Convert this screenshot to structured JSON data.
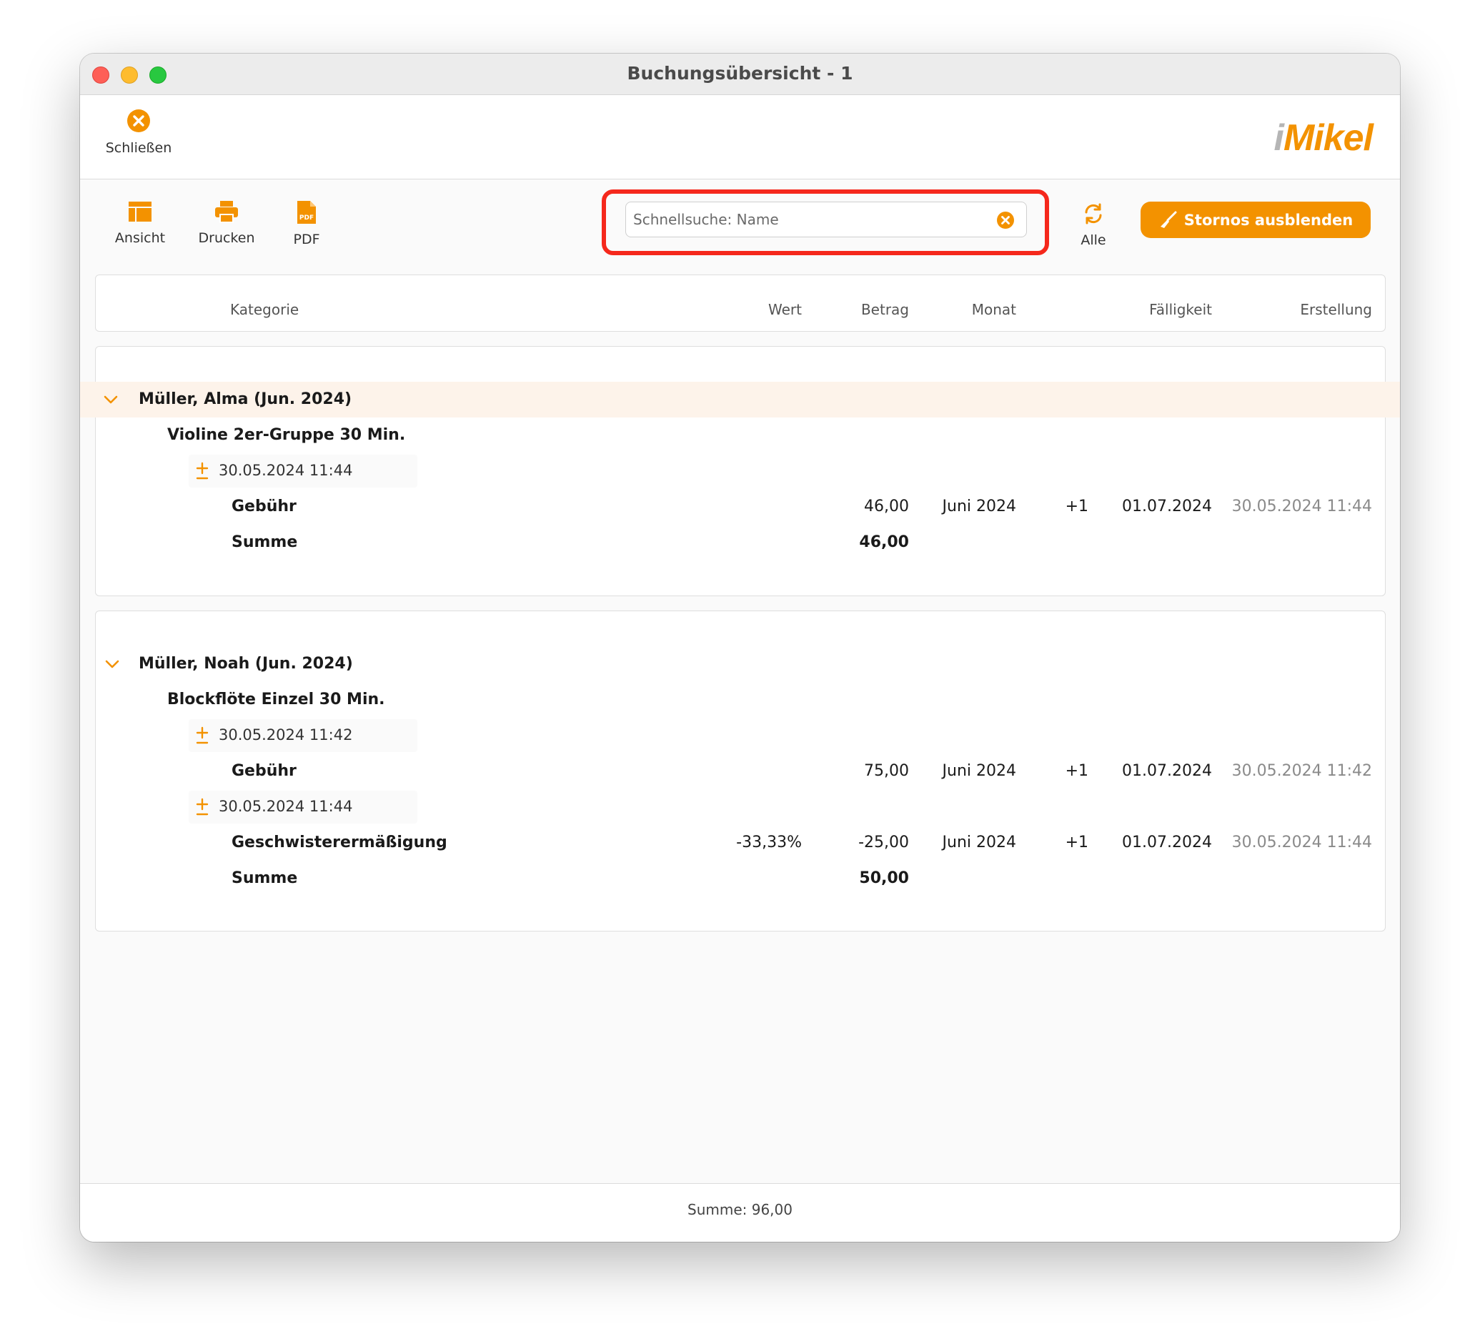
{
  "window": {
    "title": "Buchungsübersicht - 1"
  },
  "toolbar": {
    "close_label": "Schließen",
    "view_label": "Ansicht",
    "print_label": "Drucken",
    "pdf_label": "PDF",
    "logo_text_i": "i",
    "logo_text_rest": "Mikel"
  },
  "search": {
    "placeholder": "Schnellsuche: Name",
    "value": ""
  },
  "refresh_label": "Alle",
  "storno_button": "Stornos ausblenden",
  "columns": {
    "kategorie": "Kategorie",
    "wert": "Wert",
    "betrag": "Betrag",
    "monat": "Monat",
    "faelligkeit": "Fälligkeit",
    "erstellung": "Erstellung"
  },
  "groups": [
    {
      "name": "Müller, Alma (Jun. 2024)",
      "course": "Violine 2er-Gruppe 30 Min.",
      "entries": [
        {
          "timestamp": "30.05.2024 11:44",
          "category": "Gebühr",
          "wert": "",
          "betrag": "46,00",
          "monat": "Juni 2024",
          "offset": "+1",
          "faelligkeit": "01.07.2024",
          "erstellung": "30.05.2024 11:44"
        }
      ],
      "sum_label": "Summe",
      "sum_value": "46,00"
    },
    {
      "name": "Müller, Noah (Jun. 2024)",
      "course": "Blockflöte Einzel 30 Min.",
      "entries": [
        {
          "timestamp": "30.05.2024 11:42",
          "category": "Gebühr",
          "wert": "",
          "betrag": "75,00",
          "monat": "Juni 2024",
          "offset": "+1",
          "faelligkeit": "01.07.2024",
          "erstellung": "30.05.2024 11:42"
        },
        {
          "timestamp": "30.05.2024 11:44",
          "category": "Geschwisterermäßigung",
          "wert": "-33,33%",
          "betrag": "-25,00",
          "monat": "Juni 2024",
          "offset": "+1",
          "faelligkeit": "01.07.2024",
          "erstellung": "30.05.2024 11:44"
        }
      ],
      "sum_label": "Summe",
      "sum_value": "50,00"
    }
  ],
  "footer": {
    "total": "Summe: 96,00"
  },
  "colors": {
    "accent": "#f39200",
    "highlight": "#f5281c",
    "selected_row": "#fdf3ea"
  }
}
